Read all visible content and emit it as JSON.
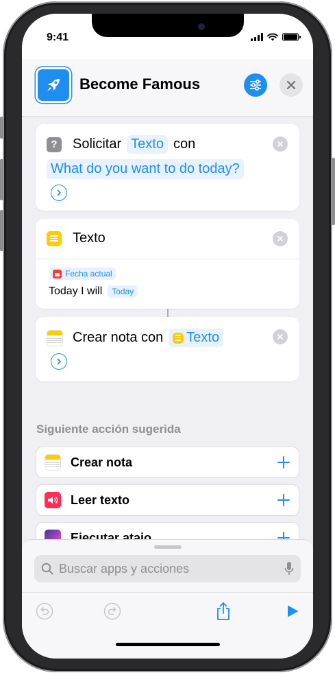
{
  "status_bar": {
    "time": "9:41"
  },
  "header": {
    "title": "Become Famous"
  },
  "actions": {
    "ask": {
      "label": "Solicitar",
      "token": "Texto",
      "connector": "con",
      "prompt": "What do you want to do today?"
    },
    "text": {
      "label": "Texto",
      "date_token": "Fecha actual",
      "body": "Today I will",
      "body_token": "Today"
    },
    "create_note": {
      "label": "Crear nota con",
      "token": "Texto"
    }
  },
  "suggestions": {
    "title": "Siguiente acción sugerida",
    "items": [
      {
        "label": "Crear nota"
      },
      {
        "label": "Leer texto"
      },
      {
        "label": "Ejecutar atajo"
      }
    ]
  },
  "search": {
    "placeholder": "Buscar apps y acciones"
  },
  "colors": {
    "accent": "#1e8ef0",
    "notes_yellow": "#ffcc00",
    "speak_red": "#ff2d55",
    "calendar_red": "#ff3b30"
  }
}
